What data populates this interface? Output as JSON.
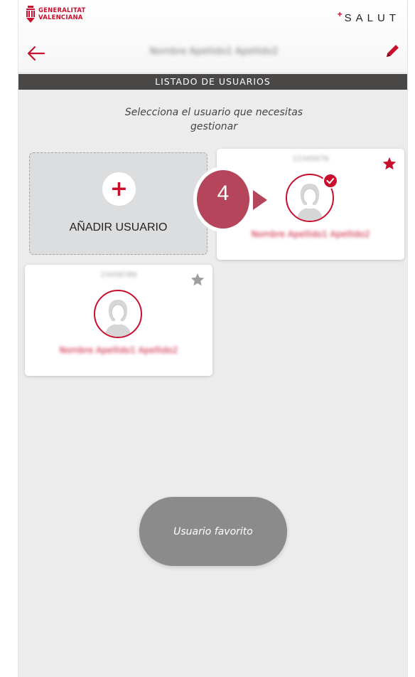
{
  "header": {
    "logo_line1": "GENERALITAT",
    "logo_line2": "VALENCIANA",
    "brand_plus": "+",
    "brand_name": "SALUT",
    "user_name": "Nombre Apellido1 Apellido2"
  },
  "section": {
    "title": "LISTADO DE USUARIOS"
  },
  "instruction": "Selecciona el usuario que necesitas gestionar",
  "add_card": {
    "plus": "+",
    "label": "AÑADIR USUARIO"
  },
  "users": [
    {
      "id": "12345678",
      "name": "Nombre Apellido1 Apellido2",
      "favorite": true,
      "selected": true
    },
    {
      "id": "23456789",
      "name": "Nombre Apellido1 Apellido2",
      "favorite": false,
      "selected": false
    }
  ],
  "callout": {
    "number": "4"
  },
  "favorite_button": {
    "label": "Usuario favorito"
  },
  "colors": {
    "accent": "#c8102e",
    "section_bar": "#4a4747",
    "background": "#ececec",
    "favorite_button": "#8b8b8b",
    "star_inactive": "#9e9e9e",
    "callout": "#b5455a"
  },
  "icons": {
    "back": "arrow-left-icon",
    "edit": "pencil-icon",
    "add": "plus-icon",
    "favorite": "star-icon",
    "avatar": "female-avatar-icon",
    "selected": "check-circle-icon"
  }
}
